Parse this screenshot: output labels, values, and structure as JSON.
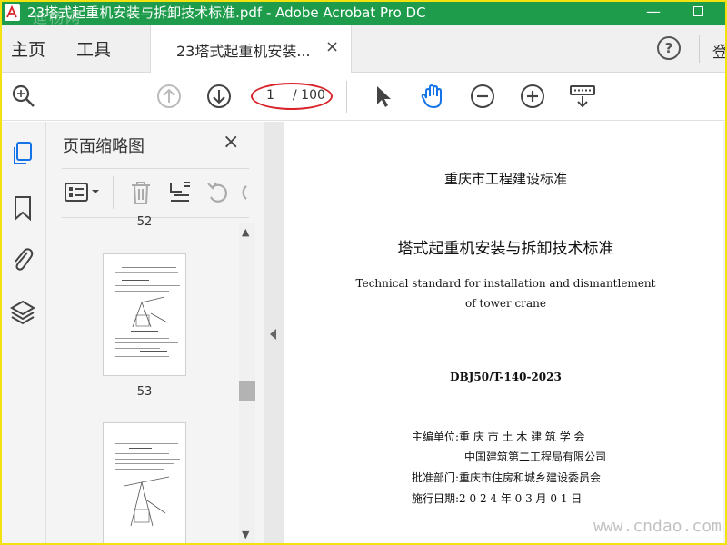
{
  "window": {
    "title": "23塔式起重机安装与拆卸技术标准.pdf - Adobe Acrobat Pro DC",
    "watermark_top": "迪杨网",
    "minimize": "—",
    "accent": "#1e9c4c"
  },
  "tabs": {
    "home": "主页",
    "tools": "工具",
    "document_tab": "23塔式起重机安装...",
    "close": "×",
    "help": "?",
    "login": "登"
  },
  "toolbar": {
    "current_page": "1",
    "total_pages": "/ 100",
    "icons": [
      "zoom-search-icon",
      "page-up-icon",
      "page-down-icon",
      "select-arrow-icon",
      "hand-tool-icon",
      "zoom-out-icon",
      "zoom-in-icon",
      "keyboard-scroll-icon"
    ]
  },
  "rail": {
    "icons": [
      "page-thumbnails-icon",
      "bookmark-icon",
      "attachment-icon",
      "layers-icon"
    ]
  },
  "thumbnail_panel": {
    "title": "页面缩略图",
    "close": "×",
    "tool_icons": [
      "thumbnail-options-icon",
      "delete-icon",
      "extract-icon",
      "rotate-icon"
    ],
    "pages": [
      {
        "number": "52"
      },
      {
        "number": "53"
      }
    ]
  },
  "document": {
    "header": "重庆市工程建设标准",
    "title_cn": "塔式起重机安装与拆卸技术标准",
    "title_en_1": "Technical standard for installation and dismantlement",
    "title_en_2": "of tower crane",
    "code": "DBJ50/T-140-2023",
    "editor": "主编单位:重 庆 市 土 木 建 筑 学 会",
    "editor_2": "中国建筑第二工程局有限公司",
    "approver": "批准部门:重庆市住房和城乡建设委员会",
    "date": "施行日期:2 0 2 4 年 0 3 月 0 1 日",
    "watermark": "www.cndao.com"
  }
}
